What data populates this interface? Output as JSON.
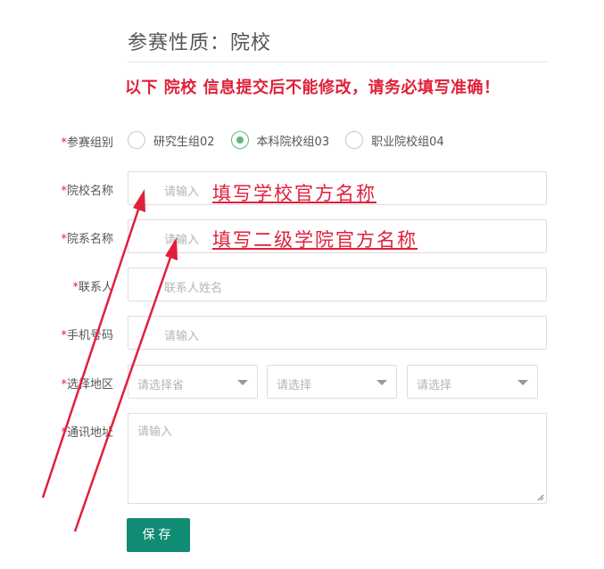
{
  "header": {
    "title": "参赛性质：院校",
    "warning": "以下 院校 信息提交后不能修改，请务必填写准确！"
  },
  "form": {
    "group": {
      "label": "参赛组别",
      "options": [
        "研究生组02",
        "本科院校组03",
        "职业院校组04"
      ],
      "selected": "本科院校组03"
    },
    "school_name": {
      "label": "院校名称",
      "placeholder": "请输入"
    },
    "dept_name": {
      "label": "院系名称",
      "placeholder": "请输入"
    },
    "contact": {
      "label": "联系人",
      "placeholder": "联系人姓名"
    },
    "phone": {
      "label": "手机号码",
      "placeholder": "请输入"
    },
    "region": {
      "label": "选择地区",
      "province": "请选择省",
      "city": "请选择",
      "district": "请选择"
    },
    "address": {
      "label": "通讯地址",
      "placeholder": "请输入"
    },
    "required_mark": "*",
    "save_label": "保存"
  },
  "annotations": {
    "school_hint": "填写学校官方名称",
    "dept_hint": "填写二级学院官方名称",
    "color": "#e0203a"
  },
  "colors": {
    "accent": "#0f8c73",
    "radio_checked": "#5fb878",
    "warning": "#e0203a"
  }
}
